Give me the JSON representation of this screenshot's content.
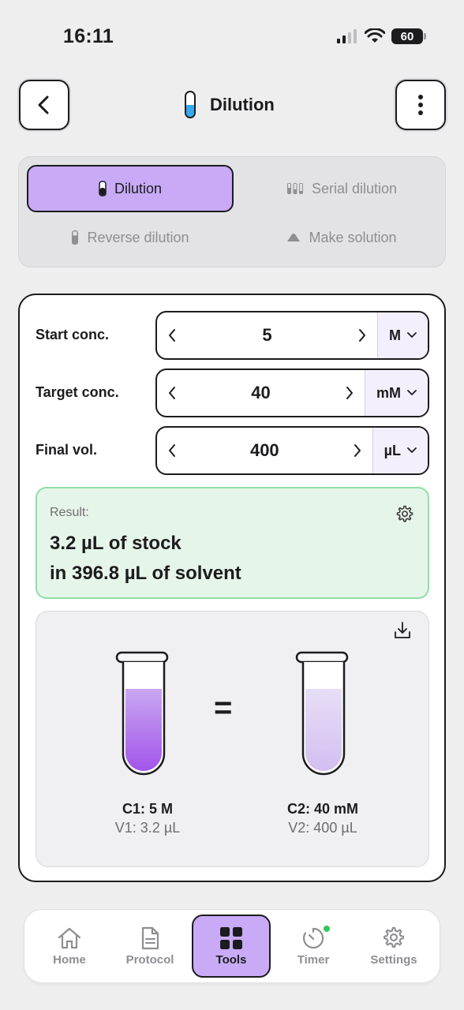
{
  "status_bar": {
    "time": "16:11",
    "battery": "60"
  },
  "header": {
    "title": "Dilution"
  },
  "modes": {
    "dilution": "Dilution",
    "serial": "Serial dilution",
    "reverse": "Reverse dilution",
    "make": "Make solution",
    "active": "dilution"
  },
  "form": {
    "start": {
      "label": "Start conc.",
      "value": "5",
      "unit": "M"
    },
    "target": {
      "label": "Target conc.",
      "value": "40",
      "unit": "mM"
    },
    "final": {
      "label": "Final vol.",
      "value": "400",
      "unit": "µL"
    }
  },
  "result": {
    "label": "Result:",
    "line1": "3.2 µL of stock",
    "line2": "in 396.8 µL of solvent"
  },
  "visual": {
    "equals": "=",
    "left": {
      "c": "C1: 5 M",
      "v": "V1: 3.2 µL"
    },
    "right": {
      "c": "C2: 40 mM",
      "v": "V2: 400 µL"
    }
  },
  "nav": {
    "home": "Home",
    "protocol": "Protocol",
    "tools": "Tools",
    "timer": "Timer",
    "settings": "Settings",
    "active": "tools"
  },
  "colors": {
    "accent": "#c9aaf7",
    "result_bg": "#e6f5ea",
    "result_border": "#8fdfa7",
    "tube_icon": "#36a9f2",
    "stock_liquid": "#a355ea",
    "diluted_liquid": "#dccdf3"
  }
}
